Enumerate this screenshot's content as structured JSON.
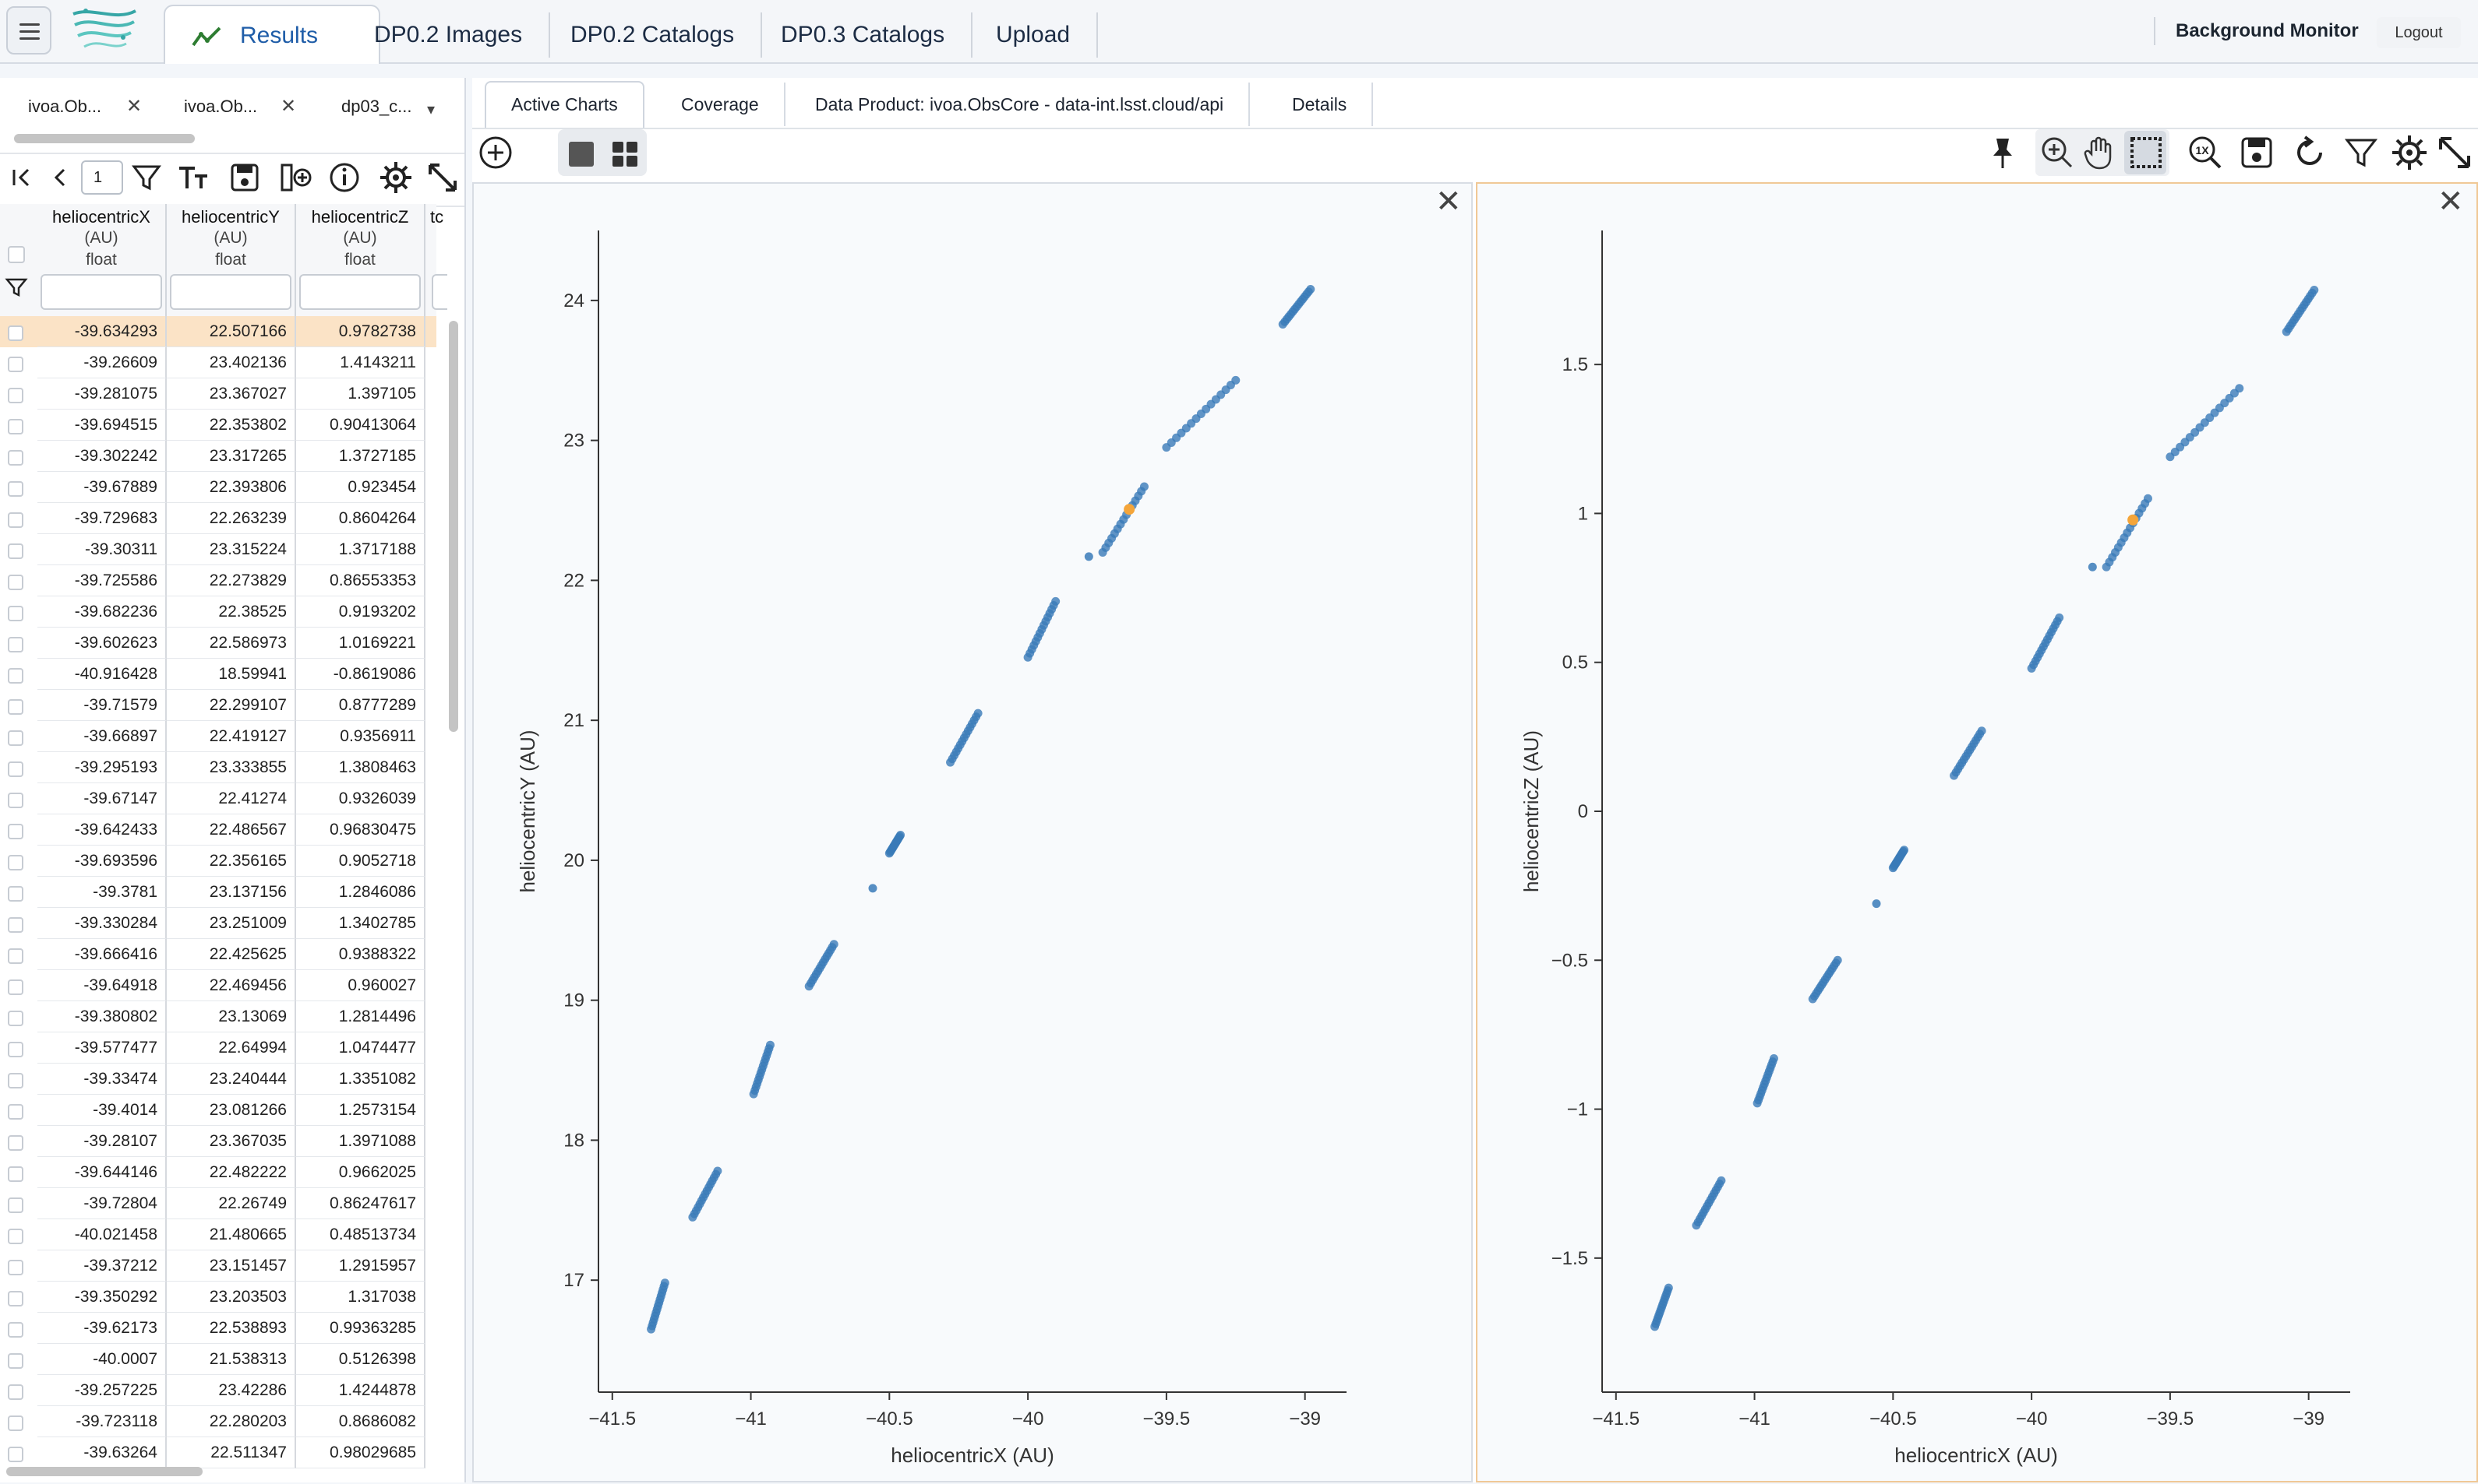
{
  "topnav": {
    "tabs": [
      "Results",
      "DP0.2 Images",
      "DP0.2 Catalogs",
      "DP0.3 Catalogs",
      "Upload"
    ],
    "background_monitor": "Background Monitor",
    "logout": "Logout"
  },
  "left": {
    "result_tabs": [
      "ivoa.Ob...",
      "ivoa.Ob...",
      "dp03_c..."
    ],
    "page_number": "1",
    "columns": [
      {
        "name": "heliocentricX",
        "unit": "(AU)",
        "type": "float"
      },
      {
        "name": "heliocentricY",
        "unit": "(AU)",
        "type": "float"
      },
      {
        "name": "heliocentricZ",
        "unit": "(AU)",
        "type": "float"
      },
      {
        "name": "tc"
      }
    ],
    "rows": [
      [
        "-39.634293",
        "22.507166",
        "0.9782738"
      ],
      [
        "-39.26609",
        "23.402136",
        "1.4143211"
      ],
      [
        "-39.281075",
        "23.367027",
        "1.397105"
      ],
      [
        "-39.694515",
        "22.353802",
        "0.90413064"
      ],
      [
        "-39.302242",
        "23.317265",
        "1.3727185"
      ],
      [
        "-39.67889",
        "22.393806",
        "0.923454"
      ],
      [
        "-39.729683",
        "22.263239",
        "0.8604264"
      ],
      [
        "-39.30311",
        "23.315224",
        "1.3717188"
      ],
      [
        "-39.725586",
        "22.273829",
        "0.86553353"
      ],
      [
        "-39.682236",
        "22.38525",
        "0.9193202"
      ],
      [
        "-39.602623",
        "22.586973",
        "1.0169221"
      ],
      [
        "-40.916428",
        "18.59941",
        "-0.8619086"
      ],
      [
        "-39.71579",
        "22.299107",
        "0.8777289"
      ],
      [
        "-39.66897",
        "22.419127",
        "0.9356911"
      ],
      [
        "-39.295193",
        "23.333855",
        "1.3808463"
      ],
      [
        "-39.67147",
        "22.41274",
        "0.9326039"
      ],
      [
        "-39.642433",
        "22.486567",
        "0.96830475"
      ],
      [
        "-39.693596",
        "22.356165",
        "0.9052718"
      ],
      [
        "-39.3781",
        "23.137156",
        "1.2846086"
      ],
      [
        "-39.330284",
        "23.251009",
        "1.3402785"
      ],
      [
        "-39.666416",
        "22.425625",
        "0.9388322"
      ],
      [
        "-39.64918",
        "22.469456",
        "0.960027"
      ],
      [
        "-39.380802",
        "23.13069",
        "1.2814496"
      ],
      [
        "-39.577477",
        "22.64994",
        "1.0474477"
      ],
      [
        "-39.33474",
        "23.240444",
        "1.3351082"
      ],
      [
        "-39.4014",
        "23.081266",
        "1.2573154"
      ],
      [
        "-39.28107",
        "23.367035",
        "1.3971088"
      ],
      [
        "-39.644146",
        "22.482222",
        "0.9662025"
      ],
      [
        "-39.72804",
        "22.26749",
        "0.86247617"
      ],
      [
        "-40.021458",
        "21.480665",
        "0.48513734"
      ],
      [
        "-39.37212",
        "23.151457",
        "1.2915957"
      ],
      [
        "-39.350292",
        "23.203503",
        "1.317038"
      ],
      [
        "-39.62173",
        "22.538893",
        "0.99363285"
      ],
      [
        "-40.0007",
        "21.538313",
        "0.5126398"
      ],
      [
        "-39.257225",
        "23.42286",
        "1.4244878"
      ],
      [
        "-39.723118",
        "22.280203",
        "0.8686082"
      ],
      [
        "-39.63264",
        "22.511347",
        "0.98029685"
      ]
    ]
  },
  "right": {
    "tabs": [
      "Active Charts",
      "Coverage",
      "Data Product: ivoa.ObsCore - data-int.lsst.cloud/api",
      "Details"
    ]
  },
  "colors": {
    "point": "#3a7ab8",
    "highlight": "#f4a53a",
    "selected_row": "#fbe3c6",
    "accent": "#1f5da8"
  },
  "chart_data": [
    {
      "type": "scatter",
      "xlabel": "heliocentricX (AU)",
      "ylabel": "heliocentricY (AU)",
      "xlim": [
        -41.55,
        -38.85
      ],
      "ylim": [
        16.2,
        24.5
      ],
      "xticks": [
        -41.5,
        -41,
        -40.5,
        -40,
        -39.5,
        -39
      ],
      "xtick_labels": [
        "−41.5",
        "−41",
        "−40.5",
        "−40",
        "−39.5",
        "−39"
      ],
      "yticks": [
        17,
        18,
        19,
        20,
        21,
        22,
        23,
        24
      ],
      "ytick_labels": [
        "17",
        "18",
        "19",
        "20",
        "21",
        "22",
        "23",
        "24"
      ],
      "segments": [
        [
          -41.36,
          16.65,
          -41.31,
          16.98
        ],
        [
          -41.21,
          17.45,
          -41.12,
          17.78
        ],
        [
          -40.99,
          18.33,
          -40.93,
          18.68
        ],
        [
          -40.79,
          19.1,
          -40.7,
          19.4
        ],
        [
          -40.5,
          20.05,
          -40.46,
          20.18
        ],
        [
          -40.28,
          20.7,
          -40.18,
          21.05
        ],
        [
          -40.0,
          21.45,
          -39.9,
          21.85
        ],
        [
          -39.73,
          22.2,
          -39.58,
          22.67
        ],
        [
          -39.5,
          22.95,
          -39.25,
          23.43
        ],
        [
          -39.08,
          23.83,
          -38.98,
          24.08
        ]
      ],
      "single_points": [
        [
          -40.56,
          19.8
        ],
        [
          -39.78,
          22.17
        ]
      ],
      "highlight": [
        -39.634293,
        22.507166
      ]
    },
    {
      "type": "scatter",
      "xlabel": "heliocentricX (AU)",
      "ylabel": "heliocentricZ (AU)",
      "xlim": [
        -41.55,
        -38.85
      ],
      "ylim": [
        -1.95,
        1.95
      ],
      "xticks": [
        -41.5,
        -41,
        -40.5,
        -40,
        -39.5,
        -39
      ],
      "xtick_labels": [
        "−41.5",
        "−41",
        "−40.5",
        "−40",
        "−39.5",
        "−39"
      ],
      "yticks": [
        -1.5,
        -1,
        -0.5,
        0,
        0.5,
        1,
        1.5
      ],
      "ytick_labels": [
        "−1.5",
        "−1",
        "−0.5",
        "0",
        "0.5",
        "1",
        "1.5"
      ],
      "segments": [
        [
          -41.36,
          -1.73,
          -41.31,
          -1.6
        ],
        [
          -41.21,
          -1.39,
          -41.12,
          -1.24
        ],
        [
          -40.99,
          -0.98,
          -40.93,
          -0.83
        ],
        [
          -40.79,
          -0.63,
          -40.7,
          -0.5
        ],
        [
          -40.5,
          -0.19,
          -40.46,
          -0.13
        ],
        [
          -40.28,
          0.12,
          -40.18,
          0.27
        ],
        [
          -40.0,
          0.48,
          -39.9,
          0.65
        ],
        [
          -39.73,
          0.82,
          -39.58,
          1.05
        ],
        [
          -39.5,
          1.19,
          -39.25,
          1.42
        ],
        [
          -39.08,
          1.61,
          -38.98,
          1.75
        ]
      ],
      "single_points": [
        [
          -40.56,
          -0.31
        ],
        [
          -39.78,
          0.82
        ]
      ],
      "highlight": [
        -39.634293,
        0.9782738
      ]
    }
  ]
}
